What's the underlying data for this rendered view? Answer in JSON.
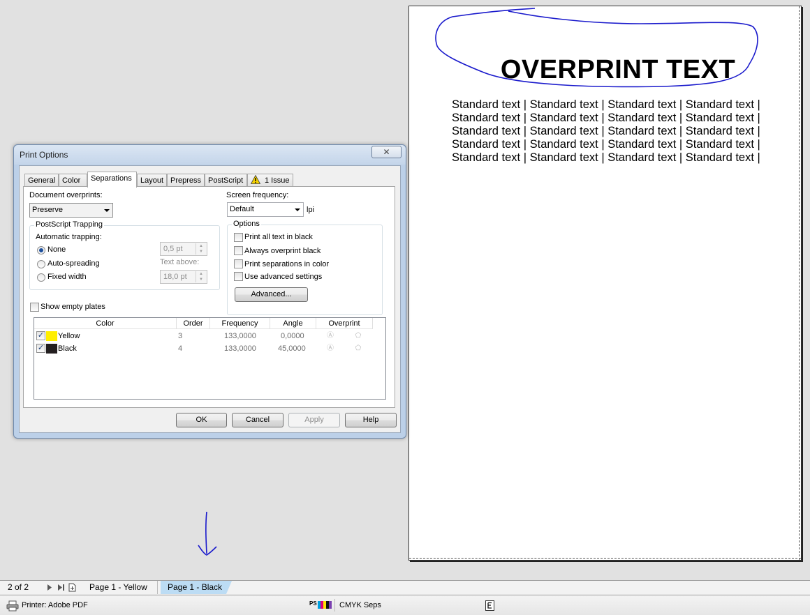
{
  "preview": {
    "title": "OVERPRINT TEXT",
    "lines": [
      "Standard text | Standard text | Standard text | Standard text |",
      "Standard text | Standard text | Standard text | Standard text |",
      "Standard text | Standard text | Standard text | Standard text |",
      "Standard text | Standard text | Standard text | Standard text |",
      "Standard text | Standard text | Standard text | Standard text |"
    ]
  },
  "dialog": {
    "title": "Print Options",
    "close_label": "✕",
    "tabs": [
      "General",
      "Color",
      "Separations",
      "Layout",
      "Prepress",
      "PostScript",
      "1 Issue"
    ],
    "active_tab": "Separations",
    "doc_overprints_label": "Document overprints:",
    "doc_overprints_value": "Preserve",
    "screen_freq_label": "Screen frequency:",
    "screen_freq_value": "Default",
    "screen_freq_unit": "lpi",
    "trapping": {
      "group_title": "PostScript Trapping",
      "auto_label": "Automatic trapping:",
      "options": [
        "None",
        "Auto-spreading",
        "Fixed width"
      ],
      "selected": "None",
      "width_value": "0,5 pt",
      "text_above_label": "Text above:",
      "text_above_value": "18,0 pt"
    },
    "options": {
      "group_title": "Options",
      "items": [
        "Print all text in black",
        "Always overprint black",
        "Print separations in color",
        "Use advanced settings"
      ],
      "advanced_label": "Advanced..."
    },
    "show_empty_plates_label": "Show empty plates",
    "colors_table": {
      "headers": [
        "Color",
        "Order",
        "Frequency",
        "Angle",
        "Overprint"
      ],
      "rows": [
        {
          "checked": "✓",
          "name": "Yellow",
          "swatch": "#ffee00",
          "order": "3",
          "frequency": "133,0000",
          "angle": "0,0000"
        },
        {
          "checked": "✓",
          "name": "Black",
          "swatch": "#231f20",
          "order": "4",
          "frequency": "133,0000",
          "angle": "45,0000"
        }
      ]
    },
    "buttons": {
      "ok": "OK",
      "cancel": "Cancel",
      "apply": "Apply",
      "help": "Help"
    }
  },
  "pagebar": {
    "counter": "2 of 2",
    "tabs": [
      "Page 1 - Yellow",
      "Page 1 - Black"
    ],
    "active_tab": "Page 1 - Black"
  },
  "statusbar": {
    "printer": "Printer: Adobe PDF",
    "mode": "CMYK Seps",
    "ps_label": "PS"
  },
  "colors": {
    "annotation_ink": "#1a1acc",
    "active_page_tab": "#bcdcf4",
    "warning": "#f5d200"
  }
}
